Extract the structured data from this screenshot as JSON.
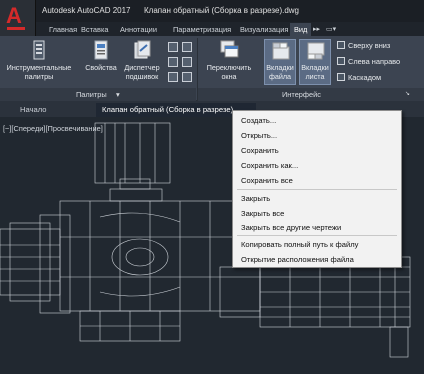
{
  "titlebar": {
    "app_logo_letter": "A",
    "app_name": "Autodesk AutoCAD 2017",
    "document_title": "Клапан обратный (Сборка в разрезе).dwg"
  },
  "ribbon_tabs": [
    {
      "label": "Главная"
    },
    {
      "label": "Вставка"
    },
    {
      "label": "Аннотации"
    },
    {
      "label": "Параметризация"
    },
    {
      "label": "Визуализация"
    },
    {
      "label": "Вид",
      "active": true
    }
  ],
  "ribbon": {
    "palettes_panel": {
      "title": "Палитры",
      "buttons": [
        {
          "label_line1": "Инструментальные",
          "label_line2": "палитры"
        },
        {
          "label_line1": "Свойства",
          "label_line2": ""
        },
        {
          "label_line1": "Диспетчер",
          "label_line2": "подшивок"
        }
      ]
    },
    "interface_panel": {
      "title": "Интерфейс",
      "buttons": [
        {
          "label_line1": "Переключить",
          "label_line2": "окна"
        },
        {
          "label_line1": "Вкладки",
          "label_line2": "файла"
        },
        {
          "label_line1": "Вкладки",
          "label_line2": "листа"
        }
      ],
      "commands": [
        {
          "label": "Сверху вниз"
        },
        {
          "label": "Слева направо"
        },
        {
          "label": "Каскадом"
        }
      ]
    }
  },
  "doc_tabs": [
    {
      "label": "Начало"
    },
    {
      "label": "Клапан обратный (Сборка в разрезе)",
      "active": true
    }
  ],
  "viewport_label": "[−][Спереди][Просвечивание]",
  "context_menu": {
    "items": [
      {
        "label": "Создать..."
      },
      {
        "label": "Открыть..."
      },
      {
        "label": "Сохранить"
      },
      {
        "label": "Сохранить как..."
      },
      {
        "label": "Сохранить все"
      },
      {
        "label": "Закрыть"
      },
      {
        "label": "Закрыть все"
      },
      {
        "label": "Закрыть все другие чертежи"
      },
      {
        "label": "Копировать полный путь к файлу"
      },
      {
        "label": "Открытие расположения файла"
      }
    ]
  },
  "colors": {
    "accent_logo": "#d42a2a",
    "ribbon_bg": "#3c4451",
    "canvas_bg": "#212830",
    "highlight_button": "#5b6b84"
  }
}
